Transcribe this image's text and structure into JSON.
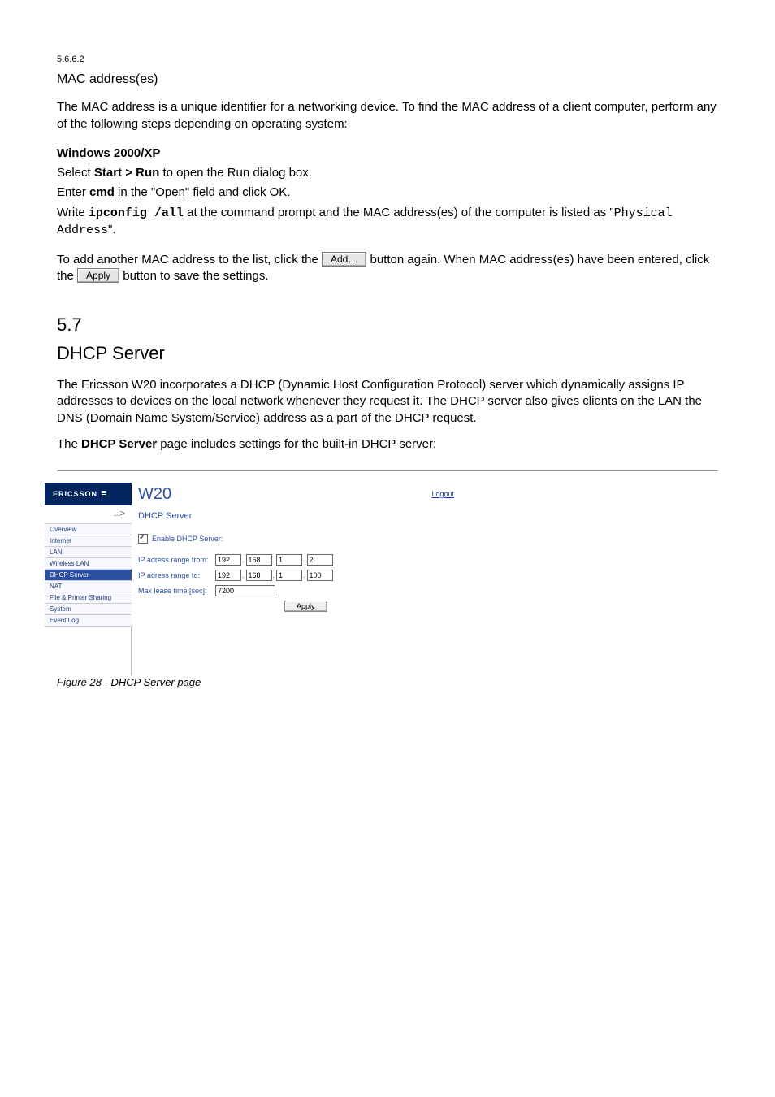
{
  "doc": {
    "sec1_num": "5.6.6.2",
    "sec1_title": "MAC address(es)",
    "para1a": "The MAC address is a unique identifier for a networking device. To find the MAC address of a client computer, perform any of the following steps depending on operating system:",
    "win_heading": "Windows 2000/XP",
    "win_step1_pre": "Select ",
    "win_step1_b": "Start > Run",
    "win_step1_post": " to open the Run dialog box.",
    "win_step2_pre": "Enter ",
    "win_step2_b": "cmd",
    "win_step2_post": " in the \"Open\" field and click OK.",
    "win_step3_pre": "Write ",
    "win_step3_cmd": "ipconfig /all",
    "win_step3_post": " at the command prompt and the MAC address(es) of the computer is listed as \"",
    "win_step3_phys": "Physical Address",
    "win_step3_tail": "\".",
    "addmore_pre": "To add another MAC address to the list, click the ",
    "addmore_btn": "Add…",
    "addmore_post": " button again. When MAC address(es) have been entered, click the ",
    "addmore_apply_btn": "Apply",
    "addmore_end": " button to save the settings.",
    "sec_big_num": "5.7",
    "sec_big_title": "DHCP Server",
    "para_big1": "The Ericsson W20 incorporates a DHCP (Dynamic Host Configuration Protocol) server which dynamically assigns IP addresses to devices on the local network whenever they request it. The DHCP server also gives clients on the LAN the DNS (Domain Name System/Service) address as a part of the DHCP request.",
    "para_big2_pre": "The ",
    "para_big2_b": "DHCP Server",
    "para_big2_post": " page includes settings for the built-in DHCP server:",
    "figure_caption_pre": "Figure 28 - ",
    "figure_caption_em": "DHCP Server page"
  },
  "shot": {
    "brand": "ERICSSON",
    "model": "W20",
    "logout": "Logout",
    "breadcrumb_dots": "...>",
    "nav": {
      "overview": "Overview",
      "internet": "Internet",
      "lan": "LAN",
      "wlan": "Wireless LAN",
      "dhcp": "DHCP Server",
      "nat": "NAT",
      "fileshare": "File & Printer Sharing",
      "system": "System",
      "eventlog": "Event Log"
    },
    "panel_title": "DHCP Server",
    "enable_label": "Enable DHCP Server:",
    "enable_checked": true,
    "from_label": "IP adress range from:",
    "to_label": "IP adress range to:",
    "lease_label": "Max lease time [sec]:",
    "ip_from": {
      "a": "192",
      "b": "168",
      "c": "1",
      "d": "2"
    },
    "ip_to": {
      "a": "192",
      "b": "168",
      "c": "1",
      "d": "100"
    },
    "lease_value": "7200",
    "apply_label": "Apply"
  }
}
